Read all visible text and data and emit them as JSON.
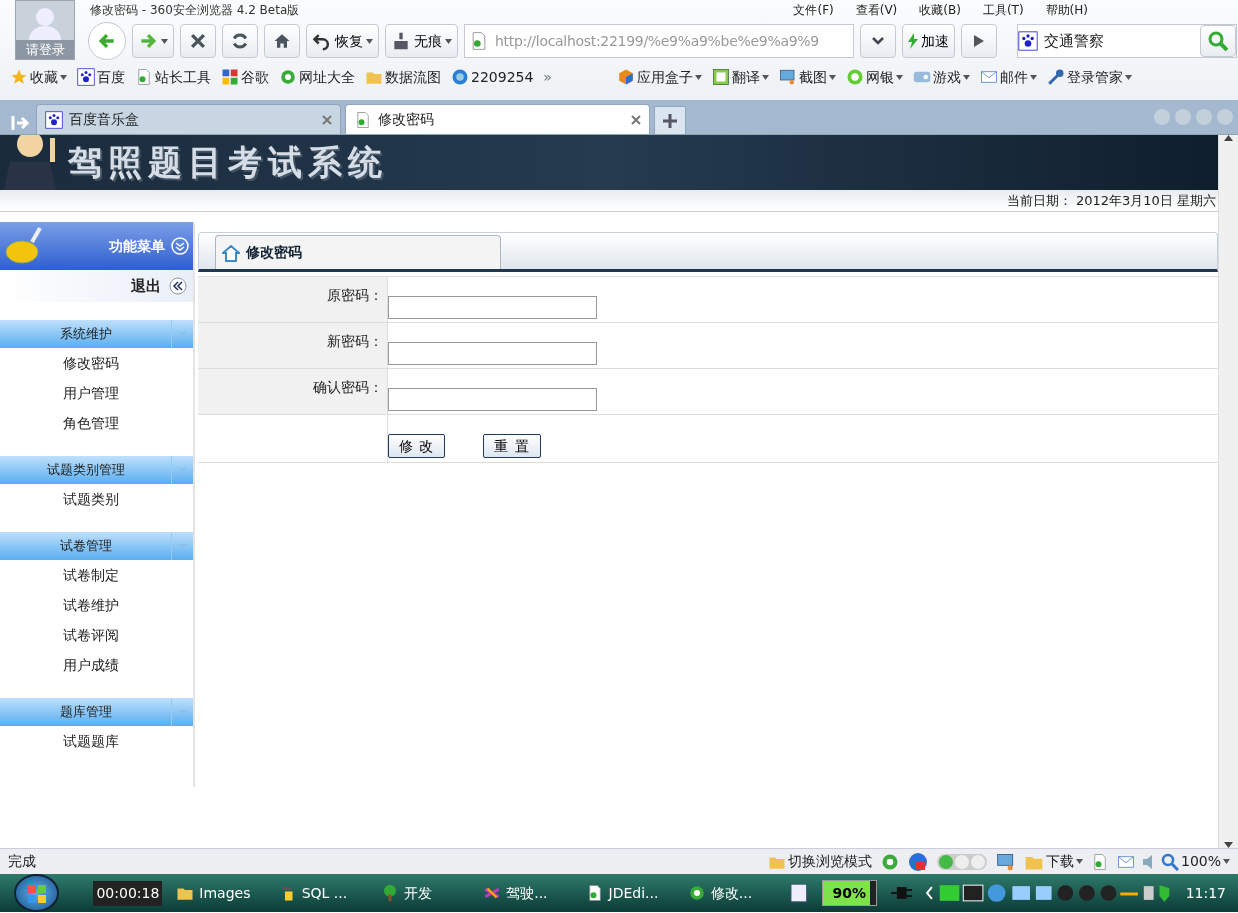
{
  "window": {
    "title": "修改密码 - 360安全浏览器 4.2 Beta版",
    "account_label": "请登录",
    "menu": [
      "文件(F)",
      "查看(V)",
      "收藏(B)",
      "工具(T)",
      "帮助(H)"
    ]
  },
  "toolbar": {
    "buttons": [
      {
        "kind": "back"
      },
      {
        "kind": "forward"
      },
      {
        "kind": "stop"
      },
      {
        "kind": "refresh"
      },
      {
        "kind": "home"
      },
      {
        "kind": "restore",
        "label": "恢复"
      },
      {
        "kind": "private",
        "label": "无痕"
      }
    ],
    "address": "http://localhost:22199/%e9%a9%be%e9%a9%9",
    "speedup": "加速",
    "search": "交通警察"
  },
  "bookmarks": {
    "left": [
      {
        "label": "收藏",
        "kind": "star"
      },
      {
        "label": "百度",
        "kind": "paw"
      },
      {
        "label": "站长工具",
        "kind": "page"
      },
      {
        "label": "谷歌",
        "kind": "google"
      },
      {
        "label": "网址大全",
        "kind": "ie"
      },
      {
        "label": "数据流图",
        "kind": "folder"
      },
      {
        "label": "2209254",
        "kind": "globe"
      }
    ],
    "more": "»",
    "right": [
      {
        "label": "应用盒子",
        "kind": "cube"
      },
      {
        "label": "翻译",
        "kind": "translate"
      },
      {
        "label": "截图",
        "kind": "screen"
      },
      {
        "label": "网银",
        "kind": "coin"
      },
      {
        "label": "游戏",
        "kind": "game"
      },
      {
        "label": "邮件",
        "kind": "mail"
      },
      {
        "label": "登录管家",
        "kind": "key"
      }
    ]
  },
  "tabs": [
    {
      "label": "百度音乐盒",
      "kind": "paw",
      "selected": false
    },
    {
      "label": "修改密码",
      "kind": "page",
      "selected": true
    }
  ],
  "site": {
    "title": "驾照题目考试系统",
    "date": "当前日期： 2012年3月10日 星期六"
  },
  "sidebar": {
    "title": "功能菜单",
    "logout": "退出",
    "groups": [
      {
        "title": "系统维护",
        "items": [
          "修改密码",
          "用户管理",
          "角色管理"
        ]
      },
      {
        "title": "试题类别管理",
        "items": [
          "试题类别"
        ]
      },
      {
        "title": "试卷管理",
        "items": [
          "试卷制定",
          "试卷维护",
          "试卷评阅",
          "用户成绩"
        ]
      },
      {
        "title": "题库管理",
        "items": [
          "试题题库"
        ]
      }
    ]
  },
  "panel": {
    "title": "修改密码",
    "fields": [
      {
        "label": "原密码："
      },
      {
        "label": "新密码："
      },
      {
        "label": "确认密码："
      }
    ],
    "buttons": [
      "修 改",
      "重 置"
    ]
  },
  "status_bar": {
    "text": "完成",
    "mode": "切换浏览模式",
    "download": "下载",
    "zoom": "100%"
  },
  "taskbar": {
    "timer": "00:00:18",
    "items": [
      {
        "label": "Images",
        "kind": "folder"
      },
      {
        "label": "SQL ...",
        "kind": "tool"
      },
      {
        "label": "开发",
        "kind": "tree"
      },
      {
        "label": "驾驶...",
        "kind": "vs"
      },
      {
        "label": "JDEdi...",
        "kind": "page"
      },
      {
        "label": "修改...",
        "kind": "ie"
      }
    ],
    "battery": {
      "reading": "90%",
      "level": 0.9
    },
    "clock": "11:17"
  }
}
